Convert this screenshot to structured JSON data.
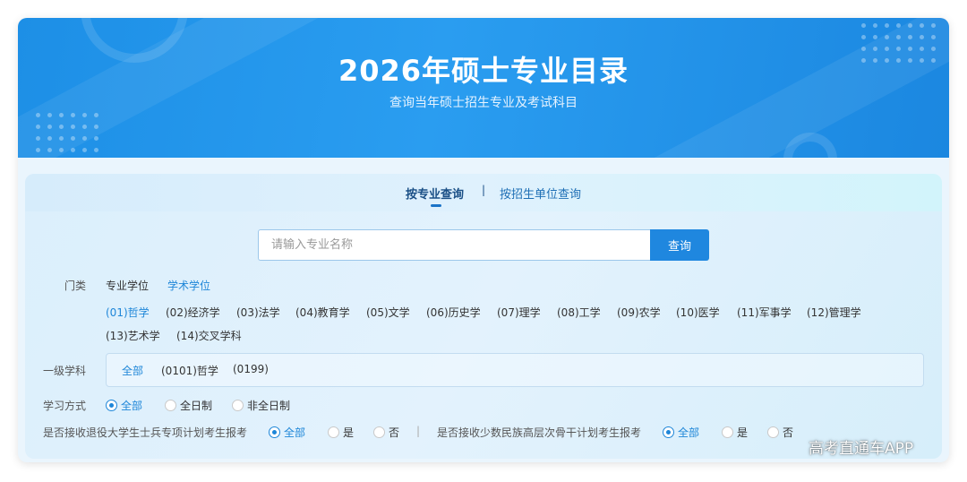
{
  "banner": {
    "title": "2026年硕士专业目录",
    "subtitle": "查询当年硕士招生专业及考试科目"
  },
  "tabs": {
    "active": "按专业查询",
    "separator": "|",
    "second": "按招生单位查询"
  },
  "search": {
    "placeholder": "请输入专业名称",
    "button_label": "查询"
  },
  "category": {
    "label": "门类",
    "degree_types": [
      "专业学位",
      "学术学位"
    ],
    "disciplines": [
      "(01)哲学",
      "(02)经济学",
      "(03)法学",
      "(04)教育学",
      "(05)文学",
      "(06)历史学",
      "(07)理学",
      "(08)工学",
      "(09)农学",
      "(10)医学",
      "(11)军事学",
      "(12)管理学",
      "(13)艺术学",
      "(14)交叉学科"
    ]
  },
  "first_level": {
    "label": "一级学科",
    "options": [
      "全部",
      "(0101)哲学",
      "(0199)"
    ]
  },
  "study_mode": {
    "label": "学习方式",
    "options": [
      "全部",
      "全日制",
      "非全日制"
    ]
  },
  "veteran_plan": {
    "label": "是否接收退役大学生士兵专项计划考生报考",
    "options": [
      "全部",
      "是",
      "否"
    ]
  },
  "minority_plan": {
    "label": "是否接收少数民族高层次骨干计划考生报考",
    "options": [
      "全部",
      "是",
      "否"
    ]
  },
  "divider": "|",
  "watermark": "高考直通车APP",
  "colors": {
    "banner": "#1d8fe6",
    "accent": "#1e86d8",
    "button": "#1f87df"
  }
}
